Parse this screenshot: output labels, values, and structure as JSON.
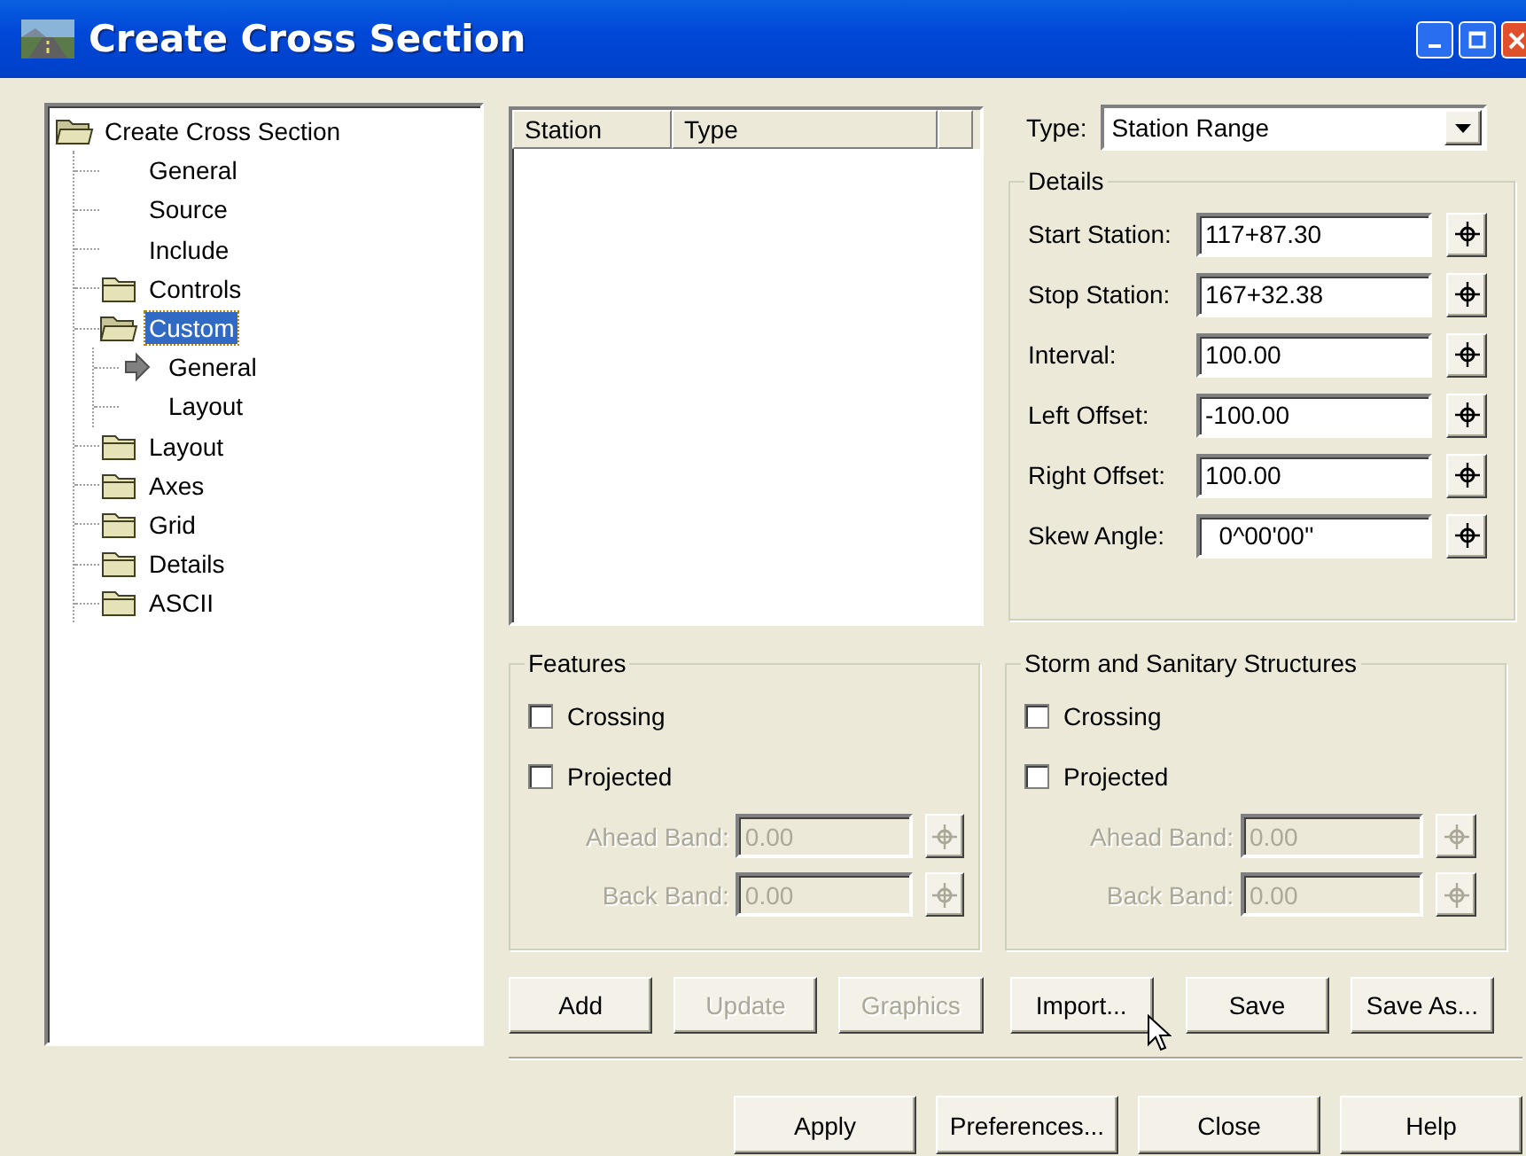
{
  "window": {
    "title": "Create Cross Section"
  },
  "tree": {
    "label": "Create Cross Section",
    "kind": "folder",
    "expanded": true,
    "selected": false,
    "children": [
      {
        "label": "General",
        "kind": "page",
        "selected": false
      },
      {
        "label": "Source",
        "kind": "page",
        "selected": false
      },
      {
        "label": "Include",
        "kind": "page",
        "selected": false
      },
      {
        "label": "Controls",
        "kind": "folder",
        "expanded": false,
        "selected": false
      },
      {
        "label": "Custom",
        "kind": "folder",
        "expanded": true,
        "selected": true,
        "children": [
          {
            "label": "General",
            "kind": "current",
            "selected": false
          },
          {
            "label": "Layout",
            "kind": "page",
            "selected": false
          }
        ]
      },
      {
        "label": "Layout",
        "kind": "folder",
        "expanded": false,
        "selected": false
      },
      {
        "label": "Axes",
        "kind": "folder",
        "expanded": false,
        "selected": false
      },
      {
        "label": "Grid",
        "kind": "folder",
        "expanded": false,
        "selected": false
      },
      {
        "label": "Details",
        "kind": "folder",
        "expanded": false,
        "selected": false
      },
      {
        "label": "ASCII",
        "kind": "folder",
        "expanded": false,
        "selected": false
      }
    ]
  },
  "list": {
    "columns": [
      "Station",
      "Type"
    ]
  },
  "type_field": {
    "label": "Type:",
    "value": "Station Range"
  },
  "details": {
    "title": "Details",
    "rows": [
      {
        "label": "Start Station:",
        "value": "117+87.30"
      },
      {
        "label": "Stop Station:",
        "value": "167+32.38"
      },
      {
        "label": "Interval:",
        "value": "100.00"
      },
      {
        "label": "Left Offset:",
        "value": "-100.00"
      },
      {
        "label": "Right Offset:",
        "value": "100.00"
      },
      {
        "label": "Skew Angle:",
        "value": "  0^00'00''"
      }
    ]
  },
  "groups": [
    {
      "title": "Features",
      "options": [
        {
          "label": "Crossing",
          "checked": false
        },
        {
          "label": "Projected",
          "checked": false
        }
      ],
      "bands": [
        {
          "label": "Ahead Band:",
          "value": "0.00",
          "disabled": true
        },
        {
          "label": "Back Band:",
          "value": "0.00",
          "disabled": true
        }
      ]
    },
    {
      "title": "Storm and Sanitary Structures",
      "options": [
        {
          "label": "Crossing",
          "checked": false
        },
        {
          "label": "Projected",
          "checked": false
        }
      ],
      "bands": [
        {
          "label": "Ahead Band:",
          "value": "0.00",
          "disabled": true
        },
        {
          "label": "Back Band:",
          "value": "0.00",
          "disabled": true
        }
      ]
    }
  ],
  "action_buttons": [
    {
      "label": "Add",
      "disabled": false
    },
    {
      "label": "Update",
      "disabled": true
    },
    {
      "label": "Graphics",
      "disabled": true
    },
    {
      "label": "Import...",
      "disabled": false
    },
    {
      "label": "Save",
      "disabled": false
    },
    {
      "label": "Save As...",
      "disabled": false
    }
  ],
  "dialog_buttons": [
    {
      "label": "Apply"
    },
    {
      "label": "Preferences..."
    },
    {
      "label": "Close"
    },
    {
      "label": "Help"
    }
  ]
}
